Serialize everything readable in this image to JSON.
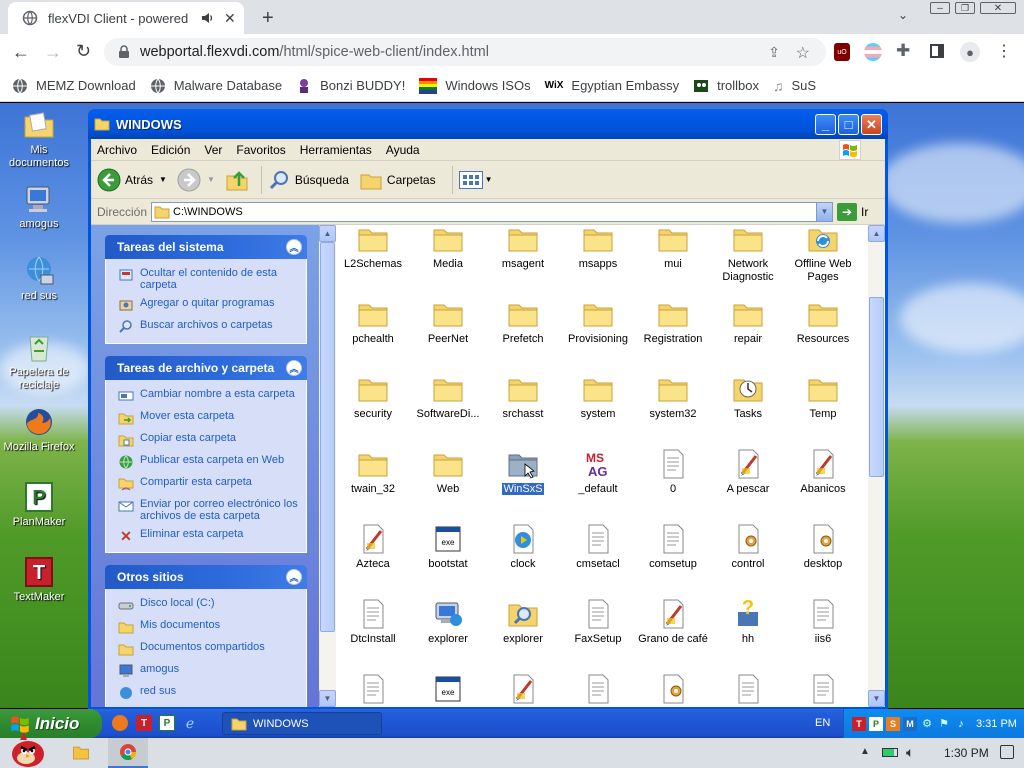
{
  "browser": {
    "tab_title": "flexVDI Client - powered b",
    "url_host": "webportal.flexvdi.com",
    "url_path": "/html/spice-web-client/index.html",
    "bookmarks": [
      {
        "label": "MEMZ Download",
        "icon": "globe-icon"
      },
      {
        "label": "Malware Database",
        "icon": "globe-icon"
      },
      {
        "label": "Bonzi BUDDY!",
        "icon": "bonzi-icon"
      },
      {
        "label": "Windows ISOs",
        "icon": "windows-flag-icon"
      },
      {
        "label": "Egyptian Embassy",
        "icon": "wix-icon"
      },
      {
        "label": "trollbox",
        "icon": "trollbox-icon"
      },
      {
        "label": "SuS",
        "icon": "sus-icon"
      }
    ],
    "wix_text": "WiX"
  },
  "desktop_icons": [
    {
      "label": "Mis documentos",
      "icon": "documents-folder-icon"
    },
    {
      "label": "amogus",
      "icon": "computer-icon"
    },
    {
      "label": "red sus",
      "icon": "network-icon"
    },
    {
      "label": "Papelera de reciclaje",
      "icon": "recycle-bin-icon"
    },
    {
      "label": "Mozilla Firefox",
      "icon": "firefox-icon"
    },
    {
      "label": "PlanMaker",
      "icon": "planmaker-icon"
    },
    {
      "label": "TextMaker",
      "icon": "textmaker-icon"
    }
  ],
  "window": {
    "title": "WINDOWS",
    "menu": [
      "Archivo",
      "Edición",
      "Ver",
      "Favoritos",
      "Herramientas",
      "Ayuda"
    ],
    "toolbar": {
      "back": "Atrás",
      "search": "Búsqueda",
      "folders": "Carpetas"
    },
    "address_label": "Dirección",
    "address": "C:\\WINDOWS",
    "go_label": "Ir"
  },
  "tasks": {
    "system": {
      "title": "Tareas del sistema",
      "items": [
        "Ocultar el contenido de esta carpeta",
        "Agregar o quitar programas",
        "Buscar archivos o carpetas"
      ]
    },
    "file": {
      "title": "Tareas de archivo y carpeta",
      "items": [
        "Cambiar nombre a esta carpeta",
        "Mover esta carpeta",
        "Copiar esta carpeta",
        "Publicar esta carpeta en Web",
        "Compartir esta carpeta",
        "Enviar por correo electrónico los archivos de esta carpeta",
        "Eliminar esta carpeta"
      ]
    },
    "other": {
      "title": "Otros sitios",
      "items": [
        "Disco local (C:)",
        "Mis documentos",
        "Documentos compartidos",
        "amogus",
        "red sus"
      ]
    }
  },
  "files": [
    {
      "name": "L2Schemas",
      "type": "folder"
    },
    {
      "name": "Media",
      "type": "folder"
    },
    {
      "name": "msagent",
      "type": "folder"
    },
    {
      "name": "msapps",
      "type": "folder"
    },
    {
      "name": "mui",
      "type": "folder"
    },
    {
      "name": "Network Diagnostic",
      "type": "folder"
    },
    {
      "name": "Offline Web Pages",
      "type": "offline"
    },
    {
      "name": "pchealth",
      "type": "folder"
    },
    {
      "name": "PeerNet",
      "type": "folder"
    },
    {
      "name": "Prefetch",
      "type": "folder"
    },
    {
      "name": "Provisioning",
      "type": "folder"
    },
    {
      "name": "Registration",
      "type": "folder"
    },
    {
      "name": "repair",
      "type": "folder"
    },
    {
      "name": "Resources",
      "type": "folder"
    },
    {
      "name": "security",
      "type": "folder"
    },
    {
      "name": "SoftwareDi...",
      "type": "folder"
    },
    {
      "name": "srchasst",
      "type": "folder"
    },
    {
      "name": "system",
      "type": "folder"
    },
    {
      "name": "system32",
      "type": "folder"
    },
    {
      "name": "Tasks",
      "type": "tasks"
    },
    {
      "name": "Temp",
      "type": "folder"
    },
    {
      "name": "twain_32",
      "type": "folder"
    },
    {
      "name": "Web",
      "type": "folder"
    },
    {
      "name": "WinSxS",
      "type": "folder-selected"
    },
    {
      "name": "_default",
      "type": "msag"
    },
    {
      "name": "0",
      "type": "doc"
    },
    {
      "name": "A pescar",
      "type": "paint"
    },
    {
      "name": "Abanicos",
      "type": "paint"
    },
    {
      "name": "Azteca",
      "type": "paint"
    },
    {
      "name": "bootstat",
      "type": "app"
    },
    {
      "name": "clock",
      "type": "clock"
    },
    {
      "name": "cmsetacl",
      "type": "doc"
    },
    {
      "name": "comsetup",
      "type": "doc"
    },
    {
      "name": "control",
      "type": "cfg"
    },
    {
      "name": "desktop",
      "type": "cfg"
    },
    {
      "name": "DtcInstall",
      "type": "doc"
    },
    {
      "name": "explorer",
      "type": "explorer"
    },
    {
      "name": "explorer",
      "type": "search"
    },
    {
      "name": "FaxSetup",
      "type": "doc"
    },
    {
      "name": "Grano de café",
      "type": "paint"
    },
    {
      "name": "hh",
      "type": "help"
    },
    {
      "name": "iis6",
      "type": "doc"
    },
    {
      "name": "",
      "type": "doc"
    },
    {
      "name": "",
      "type": "app"
    },
    {
      "name": "",
      "type": "paint"
    },
    {
      "name": "",
      "type": "doc"
    },
    {
      "name": "",
      "type": "cfg"
    },
    {
      "name": "",
      "type": "doc"
    },
    {
      "name": "",
      "type": "doc"
    }
  ],
  "taskbar": {
    "start_label": "Inicio",
    "task_label": "WINDOWS",
    "lang": "EN",
    "time": "3:31 PM"
  },
  "host_taskbar": {
    "time": "1:30 PM"
  },
  "colors": {
    "xp_blue": "#0054e3",
    "task_link": "#215dc6",
    "selection": "#316ac5"
  }
}
